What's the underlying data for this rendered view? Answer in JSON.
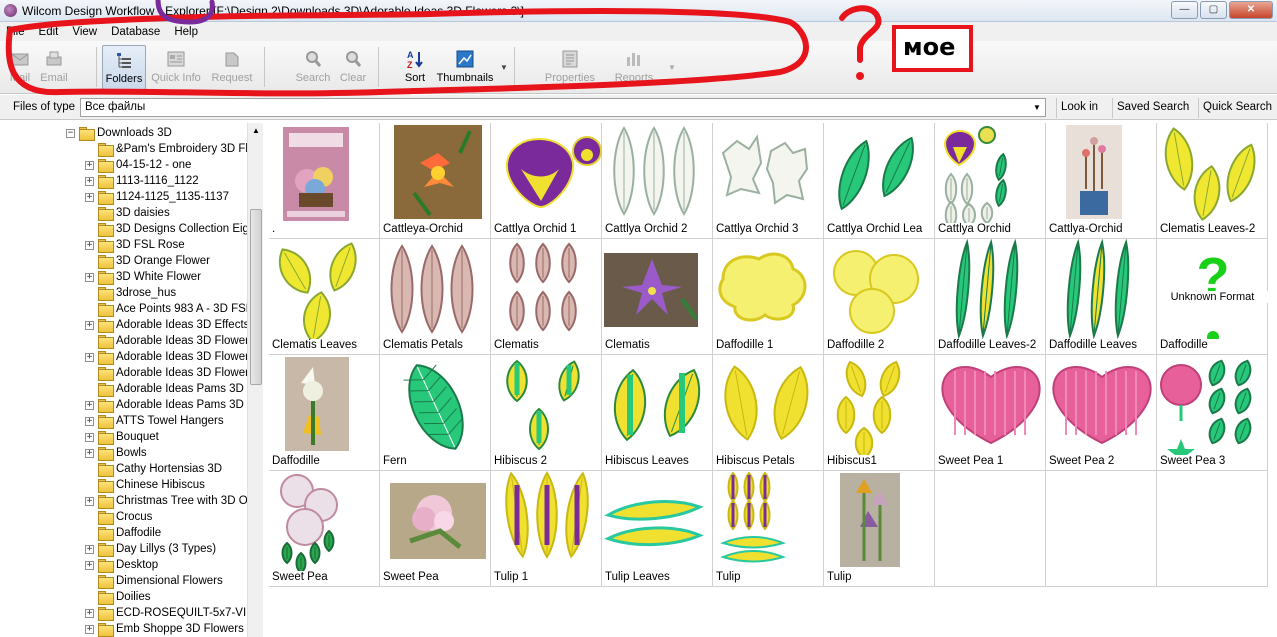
{
  "window": {
    "title": "Wilcom Design Workflow - Explorer [F:\\Design 2\\Downloads 3D\\Adorable Ideas 3D Flowers 3\\]"
  },
  "window_buttons": [
    "—",
    "▢",
    "✕"
  ],
  "menu": [
    "File",
    "Edit",
    "View",
    "Database",
    "Help"
  ],
  "toolbar": {
    "mail": "Mail",
    "email": "Email",
    "folders": "Folders",
    "quick_info": "Quick Info",
    "request": "Request",
    "search": "Search",
    "clear": "Clear",
    "sort": "Sort",
    "thumbnails": "Thumbnails",
    "properties": "Properties",
    "reports": "Reports"
  },
  "filter": {
    "label": "Files of type",
    "value": "Все файлы",
    "look_in": "Look in",
    "saved_search": "Saved Search",
    "quick_search": "Quick Search"
  },
  "annotation": {
    "label": "мое",
    "question": "?"
  },
  "tree": [
    "Downloads 3D",
    "&Pam's Embroidery 3D Flo",
    "04-15-12 - one",
    "1113-1116_1122",
    "1124-1125_1135-1137",
    "3D daisies",
    "3D Designs Collection Eigh",
    "3D FSL Rose",
    "3D Orange Flower",
    "3D White Flower",
    "3drose_hus",
    "Ace Points 983 A - 3D FSL",
    "Adorable Ideas 3D Effects",
    "Adorable Ideas 3D Flowers",
    "Adorable Ideas 3D Flowers",
    "Adorable Ideas 3D Flowers",
    "Adorable Ideas Pams 3D F",
    "Adorable Ideas Pams 3D F",
    "ATTS Towel Hangers",
    "Bouquet",
    "Bowls",
    "Cathy Hortensias 3D",
    "Chinese Hibiscus",
    "Christmas Tree with 3D Or",
    "Crocus",
    "Daffodile",
    "Day Lillys (3 Types)",
    "Desktop",
    "Dimensional Flowers",
    "Doilies",
    "ECD-ROSEQUILT-5x7-VIP",
    "Emb Shoppe 3D Flowers"
  ],
  "thumbs": [
    {
      "caption": ".",
      "kind": "photo-box"
    },
    {
      "caption": "Cattleya-Orchid",
      "kind": "photo-orchid"
    },
    {
      "caption": "Cattlya Orchid 1",
      "kind": "purple-petal"
    },
    {
      "caption": "Cattlya Orchid 2",
      "kind": "white-petals"
    },
    {
      "caption": "Cattlya Orchid 3",
      "kind": "white-lace"
    },
    {
      "caption": "Cattlya Orchid Lea",
      "kind": "green-leaves"
    },
    {
      "caption": "Cattlya Orchid",
      "kind": "orchid-set"
    },
    {
      "caption": "Cattlya-Orchid",
      "kind": "photo-vase"
    },
    {
      "caption": "Clematis Leaves-2",
      "kind": "yellow-leaves"
    },
    {
      "caption": "Clematis Leaves",
      "kind": "yellow-leaves3"
    },
    {
      "caption": "Clematis Petals",
      "kind": "pink-petals"
    },
    {
      "caption": "Clematis",
      "kind": "pink-petals6"
    },
    {
      "caption": "Clematis",
      "kind": "photo-clematis"
    },
    {
      "caption": "Daffodille 1",
      "kind": "yellow-cloud"
    },
    {
      "caption": "Daffodille 2",
      "kind": "yellow-trefoil"
    },
    {
      "caption": "Daffodille Leaves-2",
      "kind": "green-blades"
    },
    {
      "caption": "Daffodille Leaves",
      "kind": "green-blades"
    },
    {
      "caption": "Daffodille",
      "kind": "unknown"
    },
    {
      "caption": "Daffodille",
      "kind": "photo-daffodil"
    },
    {
      "caption": "Fern",
      "kind": "fern"
    },
    {
      "caption": "Hibiscus 2",
      "kind": "hibiscus-small"
    },
    {
      "caption": "Hibiscus Leaves",
      "kind": "hibiscus-leaves"
    },
    {
      "caption": "Hibiscus Petals",
      "kind": "yellow-petals2"
    },
    {
      "caption": "Hibiscus1",
      "kind": "yellow-petals5"
    },
    {
      "caption": "Sweet Pea 1",
      "kind": "pink-heart"
    },
    {
      "caption": "Sweet Pea 2",
      "kind": "pink-heart"
    },
    {
      "caption": "Sweet Pea 3",
      "kind": "sweetpea-set"
    },
    {
      "caption": "Sweet Pea",
      "kind": "sweetpea-pink"
    },
    {
      "caption": "Sweet Pea",
      "kind": "photo-sweetpea"
    },
    {
      "caption": "Tulip 1",
      "kind": "tulip-petals"
    },
    {
      "caption": "Tulip Leaves",
      "kind": "tulip-leaves"
    },
    {
      "caption": "Tulip",
      "kind": "tulip-set"
    },
    {
      "caption": "Tulip",
      "kind": "photo-tulip"
    },
    {
      "caption": "",
      "kind": "empty"
    },
    {
      "caption": "",
      "kind": "empty"
    },
    {
      "caption": "",
      "kind": "empty"
    }
  ],
  "unknown_format_text": "Unknown Format",
  "colors": {
    "annotation_red": "#e8141c",
    "annotation_purple": "#7a2a9a",
    "selection_blue": "#c9d8eb"
  }
}
